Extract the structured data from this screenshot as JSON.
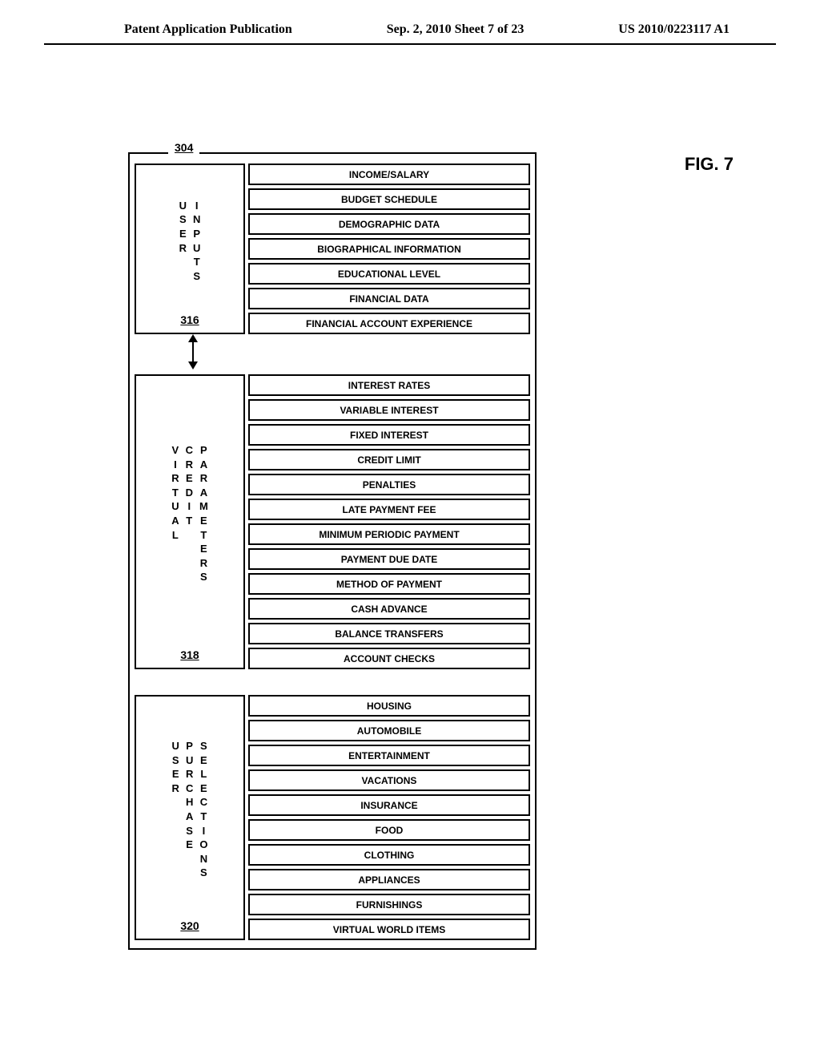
{
  "header": {
    "left": "Patent Application Publication",
    "center": "Sep. 2, 2010  Sheet 7 of 23",
    "right": "US 2010/0223117 A1"
  },
  "figure_label": "FIG. 7",
  "top_ref": "304",
  "blocks": [
    {
      "label_words": [
        "USER",
        "INPUTS"
      ],
      "ref": "316",
      "items": [
        "INCOME/SALARY",
        "BUDGET SCHEDULE",
        "DEMOGRAPHIC DATA",
        "BIOGRAPHICAL INFORMATION",
        "EDUCATIONAL LEVEL",
        "FINANCIAL DATA",
        "FINANCIAL ACCOUNT EXPERIENCE"
      ]
    },
    {
      "label_words": [
        "VIRTUAL",
        "CREDIT",
        "PARAMETERS"
      ],
      "ref": "318",
      "items": [
        "INTEREST RATES",
        "VARIABLE INTEREST",
        "FIXED INTEREST",
        "CREDIT LIMIT",
        "PENALTIES",
        "LATE PAYMENT FEE",
        "MINIMUM PERIODIC PAYMENT",
        "PAYMENT DUE DATE",
        "METHOD OF PAYMENT",
        "CASH ADVANCE",
        "BALANCE TRANSFERS",
        "ACCOUNT CHECKS"
      ]
    },
    {
      "label_words": [
        "USER",
        "PURCHASE",
        "SELECTIONS"
      ],
      "ref": "320",
      "items": [
        "HOUSING",
        "AUTOMOBILE",
        "ENTERTAINMENT",
        "VACATIONS",
        "INSURANCE",
        "FOOD",
        "CLOTHING",
        "APPLIANCES",
        "FURNISHINGS",
        "VIRTUAL WORLD ITEMS"
      ]
    }
  ]
}
